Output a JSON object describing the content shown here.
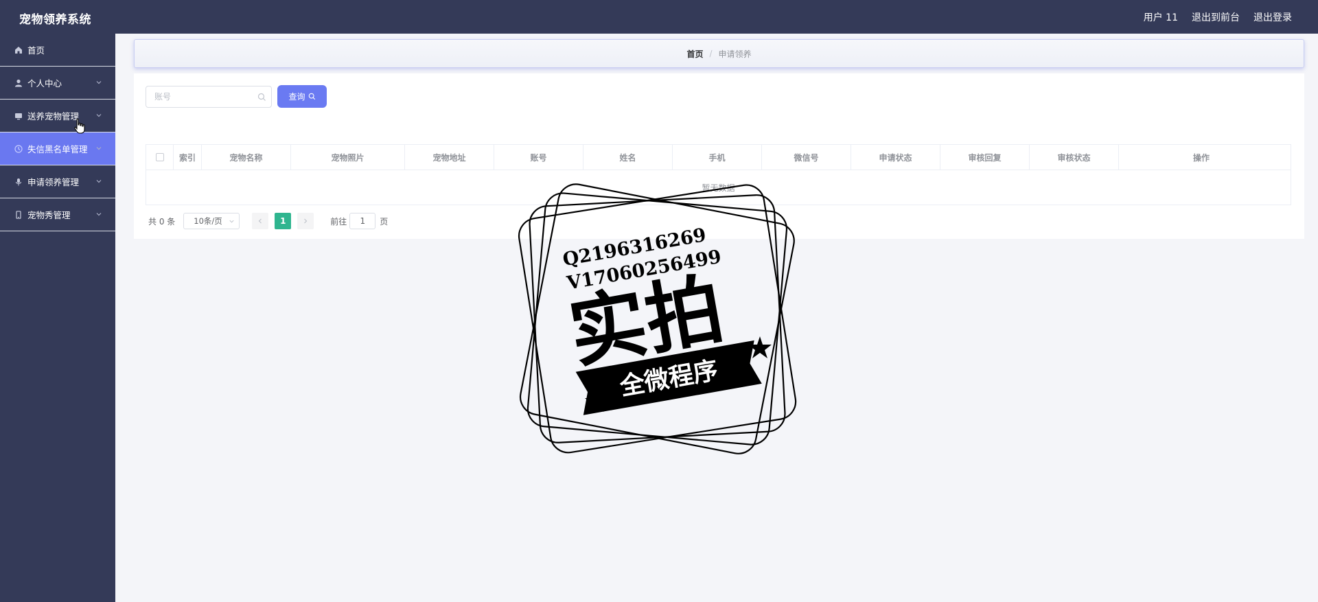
{
  "header": {
    "title": "宠物领养系统",
    "user": "用户 11",
    "back_to_front": "退出到前台",
    "logout": "退出登录"
  },
  "sidebar": {
    "items": [
      {
        "label": "首页",
        "icon": "home-icon",
        "has_submenu": false,
        "active": false
      },
      {
        "label": "个人中心",
        "icon": "user-icon",
        "has_submenu": true,
        "active": false
      },
      {
        "label": "送养宠物管理",
        "icon": "monitor-icon",
        "has_submenu": true,
        "active": false
      },
      {
        "label": "失信黑名单管理",
        "icon": "clock-icon",
        "has_submenu": true,
        "active": true
      },
      {
        "label": "申请领养管理",
        "icon": "microphone-icon",
        "has_submenu": true,
        "active": false
      },
      {
        "label": "宠物秀管理",
        "icon": "phone-icon",
        "has_submenu": true,
        "active": false
      }
    ]
  },
  "breadcrumb": {
    "home": "首页",
    "separator": "/",
    "current": "申请领养"
  },
  "search": {
    "placeholder": "账号",
    "button_label": "查询"
  },
  "table": {
    "columns": [
      "索引",
      "宠物名称",
      "宠物照片",
      "宠物地址",
      "账号",
      "姓名",
      "手机",
      "微信号",
      "申请状态",
      "审核回复",
      "审核状态",
      "操作"
    ],
    "empty_text": "暂无数据"
  },
  "pagination": {
    "total": "共 0 条",
    "page_size": "10条/页",
    "current_page": "1",
    "goto_label": "前往",
    "goto_value": "1",
    "goto_suffix": "页"
  },
  "watermark": {
    "line1": "Q2196316269",
    "line2": "V17060256499",
    "main": "实拍",
    "banner": "全微程序"
  },
  "colors": {
    "header_bg": "#343a58",
    "active_menu": "#6a78f0",
    "query_button": "#6a7af2",
    "page_active": "#2fb58f"
  }
}
